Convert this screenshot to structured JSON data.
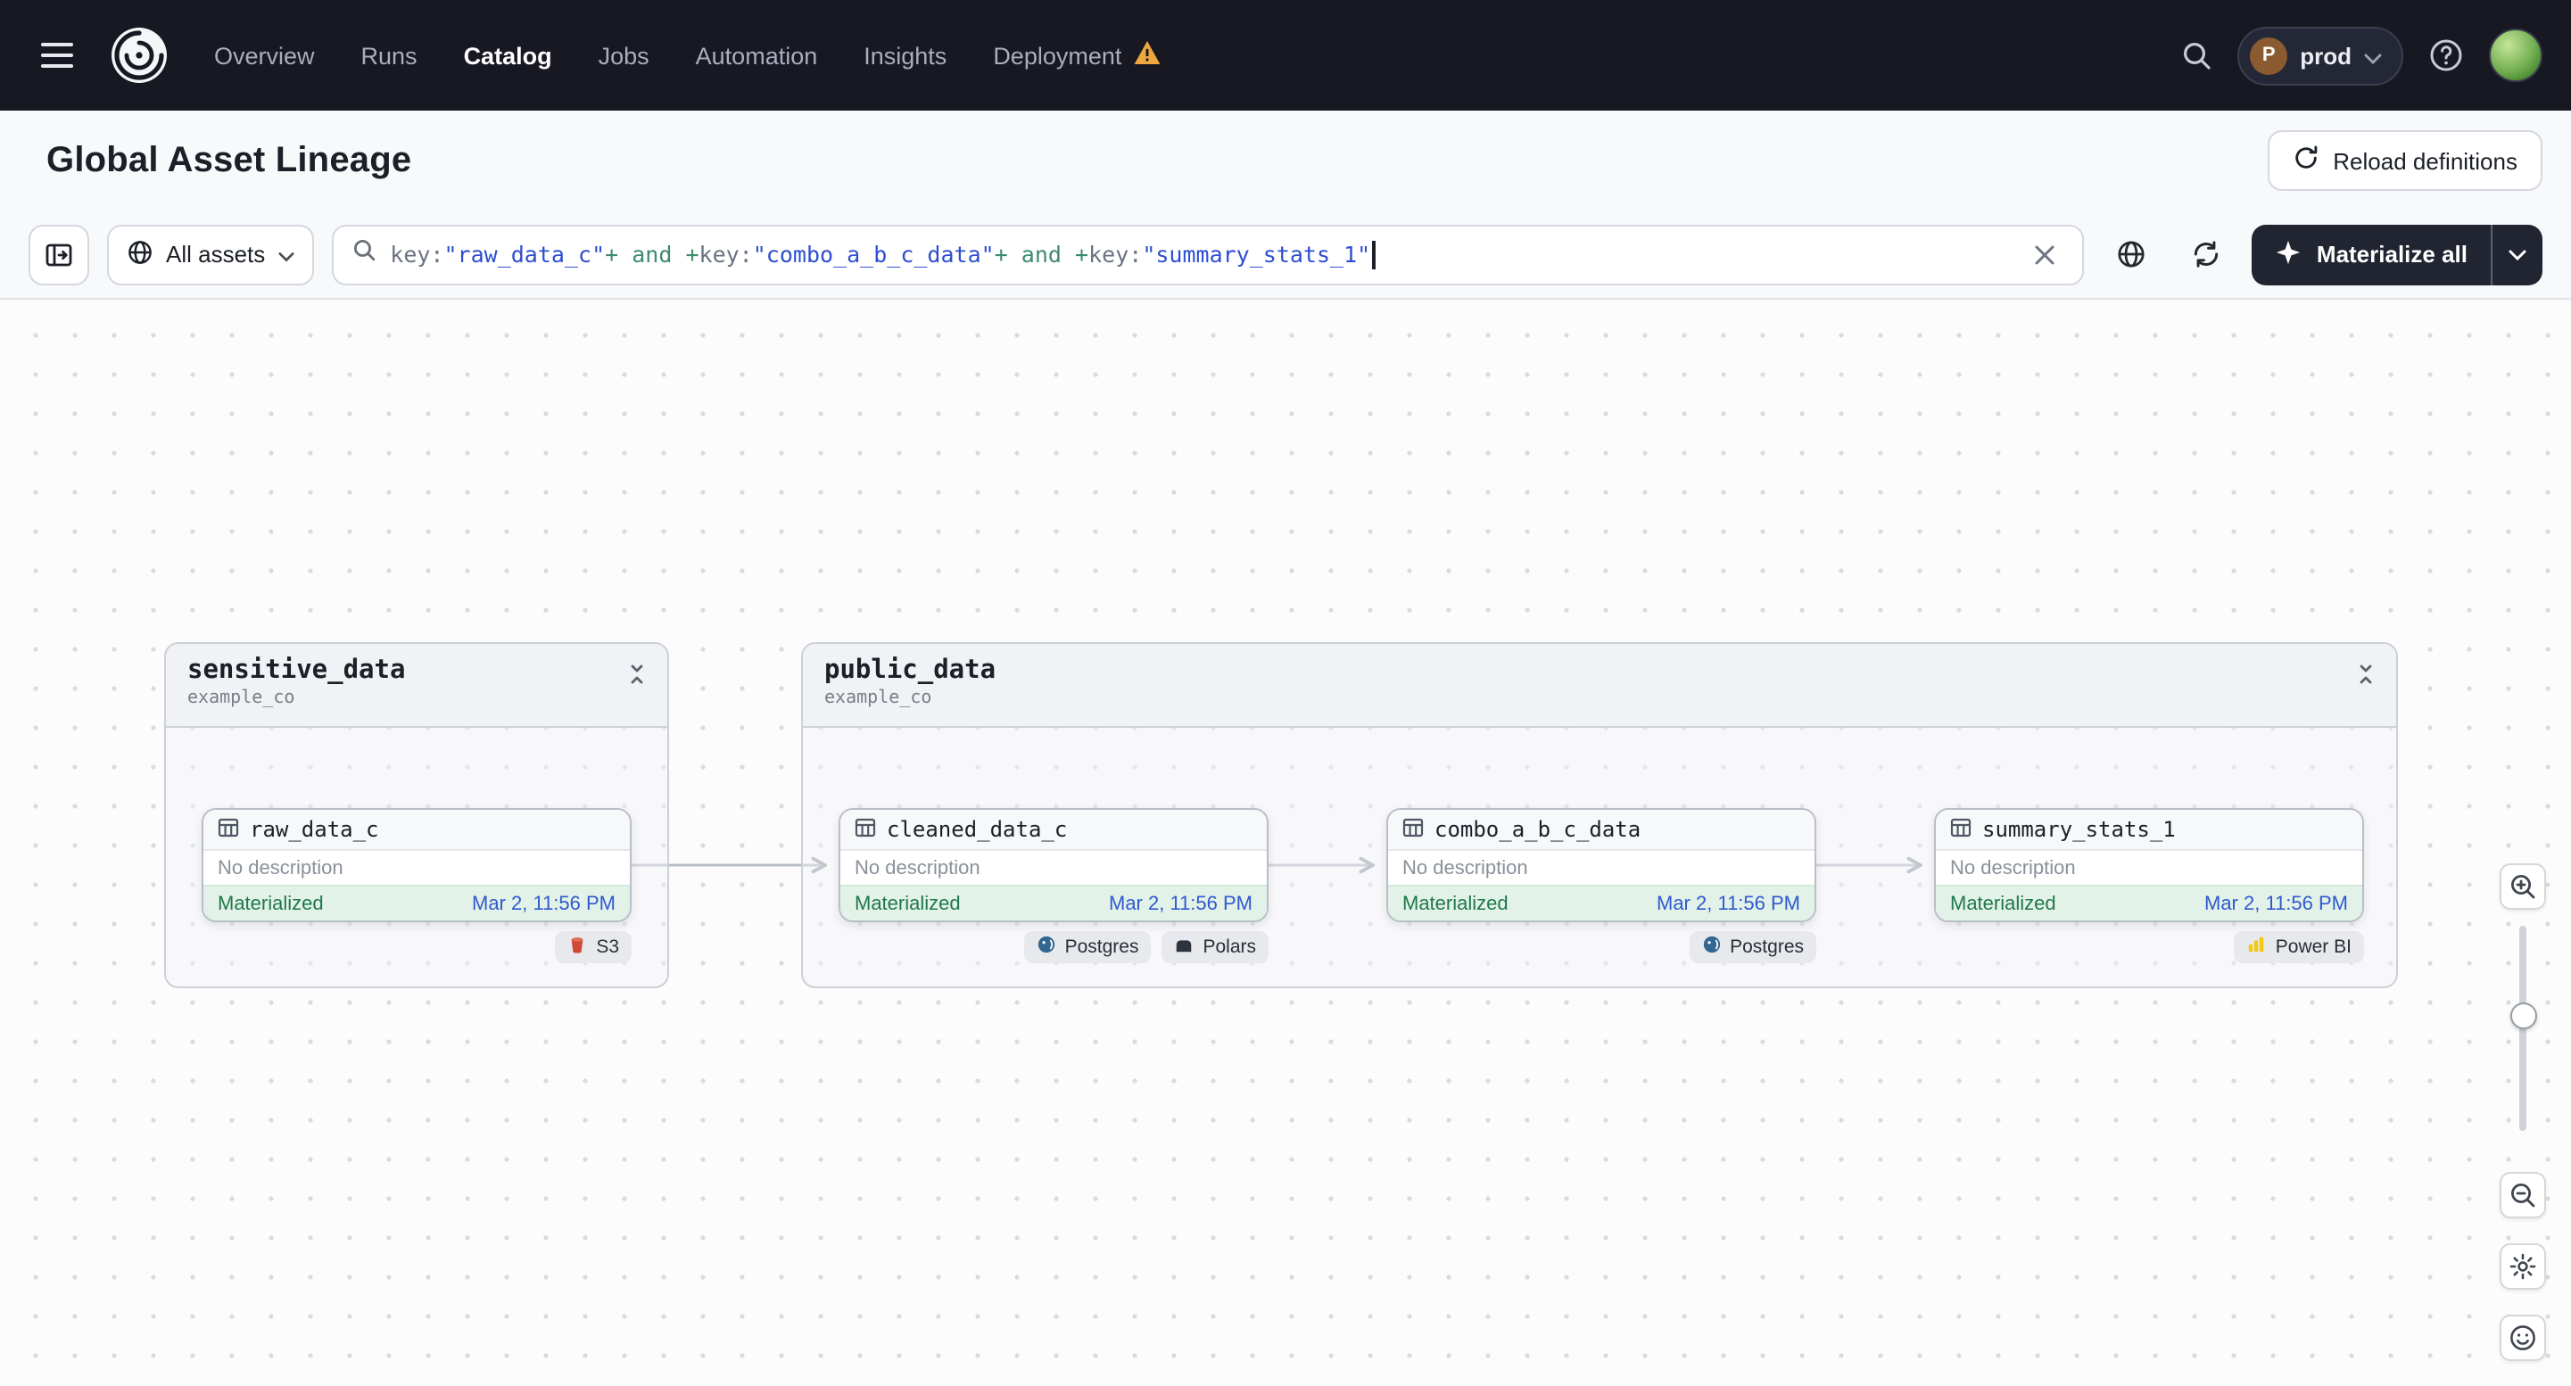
{
  "colors": {
    "nav_bg": "#171822",
    "panel_bg": "#f8f9fb",
    "border": "#d4d8de",
    "dark_button": "#212532",
    "canvas_dot": "#d9dbdf",
    "materialized_bg": "#e2f2e8",
    "materialized_text": "#20784a",
    "timestamp_blue": "#2f59cf",
    "warning_orange": "#eda73e",
    "query_key": "#6b7280",
    "query_value": "#2e4ecf",
    "query_op": "#3f8a6e"
  },
  "nav": {
    "items": [
      {
        "label": "Overview"
      },
      {
        "label": "Runs"
      },
      {
        "label": "Catalog"
      },
      {
        "label": "Jobs"
      },
      {
        "label": "Automation"
      },
      {
        "label": "Insights"
      },
      {
        "label": "Deployment"
      }
    ],
    "deployment": {
      "initial": "P",
      "name": "prod"
    }
  },
  "header": {
    "title": "Global Asset Lineage",
    "reload_label": "Reload definitions"
  },
  "toolbar": {
    "filter_label": "All assets",
    "materialize_label": "Materialize all",
    "query_parts": [
      {
        "text": "key:"
      },
      {
        "text": "\"raw_data_c\""
      },
      {
        "text": "+"
      },
      {
        "text": " and "
      },
      {
        "text": "+"
      },
      {
        "text": "key:"
      },
      {
        "text": "\"combo_a_b_c_data\""
      },
      {
        "text": "+"
      },
      {
        "text": " and "
      },
      {
        "text": "+"
      },
      {
        "text": "key:"
      },
      {
        "text": "\"summary_stats_1\""
      }
    ]
  },
  "graph": {
    "groups": [
      {
        "name": "sensitive_data",
        "location": "example_co"
      },
      {
        "name": "public_data",
        "location": "example_co"
      }
    ],
    "nodes": [
      {
        "name": "raw_data_c",
        "description": "No description",
        "status": "Materialized",
        "timestamp": "Mar 2, 11:56 PM",
        "tags": [
          {
            "label": "S3"
          }
        ]
      },
      {
        "name": "cleaned_data_c",
        "description": "No description",
        "status": "Materialized",
        "timestamp": "Mar 2, 11:56 PM",
        "tags": [
          {
            "label": "Postgres"
          },
          {
            "label": "Polars"
          }
        ]
      },
      {
        "name": "combo_a_b_c_data",
        "description": "No description",
        "status": "Materialized",
        "timestamp": "Mar 2, 11:56 PM",
        "tags": [
          {
            "label": "Postgres"
          }
        ]
      },
      {
        "name": "summary_stats_1",
        "description": "No description",
        "status": "Materialized",
        "timestamp": "Mar 2, 11:56 PM",
        "tags": [
          {
            "label": "Power BI"
          }
        ]
      }
    ]
  }
}
